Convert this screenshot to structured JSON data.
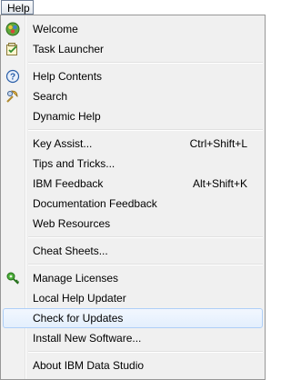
{
  "menubar": {
    "help_label": "Help"
  },
  "items": {
    "welcome": {
      "label": "Welcome"
    },
    "task_launcher": {
      "label": "Task Launcher"
    },
    "help_contents": {
      "label": "Help Contents"
    },
    "search": {
      "label": "Search"
    },
    "dynamic_help": {
      "label": "Dynamic Help"
    },
    "key_assist": {
      "label": "Key Assist...",
      "shortcut": "Ctrl+Shift+L"
    },
    "tips_and_tricks": {
      "label": "Tips and Tricks..."
    },
    "ibm_feedback": {
      "label": "IBM Feedback",
      "shortcut": "Alt+Shift+K"
    },
    "documentation_feedback": {
      "label": "Documentation Feedback"
    },
    "web_resources": {
      "label": "Web Resources"
    },
    "cheat_sheets": {
      "label": "Cheat Sheets..."
    },
    "manage_licenses": {
      "label": "Manage Licenses"
    },
    "local_help_updater": {
      "label": "Local Help Updater"
    },
    "check_for_updates": {
      "label": "Check for Updates"
    },
    "install_new_software": {
      "label": "Install New Software..."
    },
    "about": {
      "label": "About IBM Data Studio"
    }
  },
  "icons": {
    "welcome": "welcome-icon",
    "task_launcher": "task-launcher-icon",
    "help_contents": "help-contents-icon",
    "search": "search-icon",
    "manage_licenses": "key-icon"
  }
}
